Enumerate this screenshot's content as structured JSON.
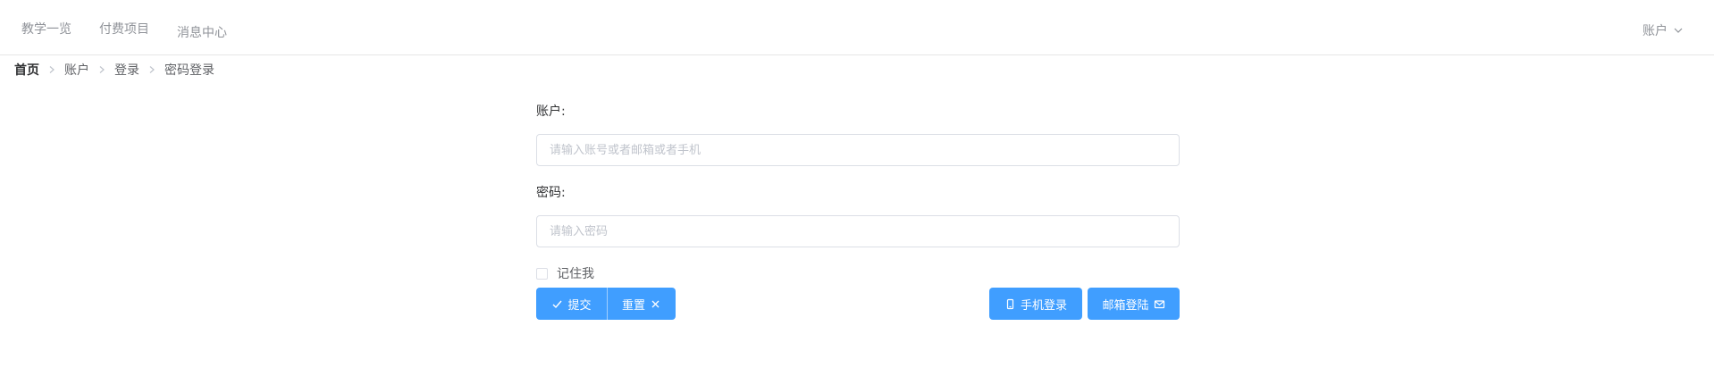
{
  "topnav": {
    "items": [
      {
        "label": "教学一览"
      },
      {
        "label": "付费项目"
      },
      {
        "label": "消息中心"
      }
    ],
    "account_label": "账户"
  },
  "breadcrumb": [
    "首页",
    "账户",
    "登录",
    "密码登录"
  ],
  "form": {
    "account_label": "账户:",
    "account_placeholder": "请输入账号或者邮箱或者手机",
    "account_value": "",
    "password_label": "密码:",
    "password_placeholder": "请输入密码",
    "password_value": "",
    "remember_label": "记住我",
    "remember_checked": false,
    "submit_label": "提交",
    "reset_label": "重置",
    "phone_login_label": "手机登录",
    "email_login_label": "邮箱登陆"
  },
  "colors": {
    "primary": "#409eff",
    "border": "#dcdfe6",
    "text_secondary": "#909399"
  },
  "icons": {
    "submit": "check-icon",
    "reset": "close-icon",
    "phone": "mobile-phone-icon",
    "email": "envelope-icon",
    "account_menu": "chevron-down-icon",
    "breadcrumb_separator": "chevron-right-icon"
  }
}
